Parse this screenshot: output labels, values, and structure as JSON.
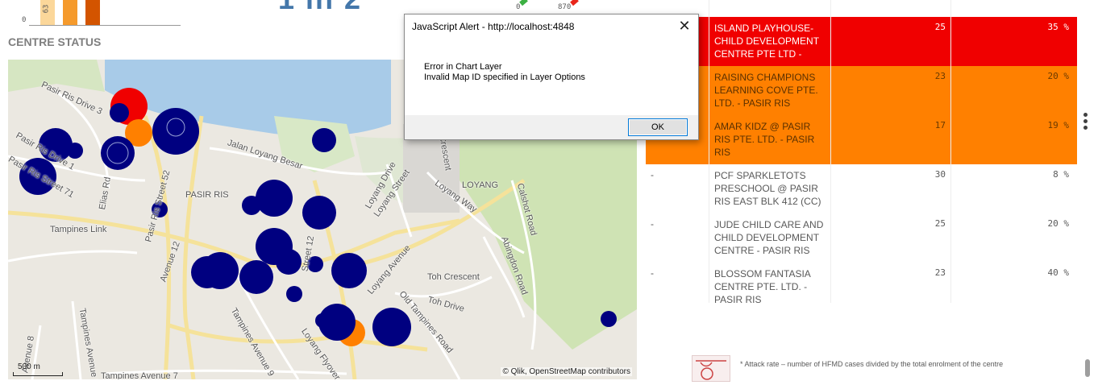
{
  "top": {
    "mini_chart": {
      "y_label": "0",
      "bar_value_label": "63"
    },
    "big_number": "1 in 2",
    "gauge_label_left": "0",
    "gauge_label_right": "870",
    "dash": "-"
  },
  "section": {
    "title": "CENTRE STATUS"
  },
  "map": {
    "labels": {
      "pasir_ris_drive_3": "Pasir Ris Drive 3",
      "pasir_ris_drive_1": "Pasir Ris Drive 1",
      "pasir_ris_street_71": "Pasir Ris Street 71",
      "elias_rd": "Elias Rd",
      "pasir_ris_street_52": "Pasir Ris Street 52",
      "pasir_ris": "PASIR RIS",
      "jalan_loyang_besar": "Jalan Loyang Besar",
      "loyang_drive": "Loyang Drive",
      "loyang_street": "Loyang Street",
      "loyang_way": "Loyang Way",
      "loyang": "LOYANG",
      "calshot_road": "Calshot Road",
      "abingdon_road": "Abingdon Road",
      "tampines_link": "Tampines Link",
      "avenue_12": "Avenue 12",
      "tampines_ave_9": "Tampines Avenue 9",
      "tampines_ave_8": "Tampines Avenue 8",
      "tampines_ave_7": "Tampines Avenue 7",
      "loyang_avenue": "Loyang Avenue",
      "toh_crescent": "Toh Crescent",
      "toh_drive": "Toh Drive",
      "old_tampines_road": "Old Tampines Road",
      "loyang_flyover": "Loyang Flyover",
      "crescent": "Crescent",
      "street_12": "Street 12",
      "avenue_8": "Avenue 8"
    },
    "scale": "500 m",
    "attribution": "© Qlik, OpenStreetMap contributors",
    "colors": {
      "high": "#f00000",
      "medium": "#ff8000",
      "low": "#000080",
      "water": "#a8cbe8",
      "green": "#cfe3b4"
    }
  },
  "table": {
    "rows": [
      {
        "status": "",
        "name": "",
        "enrolment": "",
        "rate": ""
      },
      {
        "status": "",
        "name": "ISLAND PLAYHOUSE-CHILD DEVELOPMENT CENTRE PTE LTD -",
        "enrolment": "25",
        "rate": "35 %"
      },
      {
        "status": "",
        "name": "RAISING CHAMPIONS LEARNING COVE PTE. LTD. - PASIR RIS",
        "enrolment": "23",
        "rate": "20 %"
      },
      {
        "status": "",
        "name": "AMAR KIDZ @ PASIR RIS PTE. LTD. - PASIR RIS",
        "enrolment": "17",
        "rate": "19 %"
      },
      {
        "status": "-",
        "name": "PCF SPARKLETOTS PRESCHOOL @ PASIR RIS EAST BLK 412 (CC)",
        "enrolment": "30",
        "rate": "8 %"
      },
      {
        "status": "-",
        "name": "JUDE CHILD CARE AND CHILD DEVELOPMENT CENTRE - PASIR RIS",
        "enrolment": "25",
        "rate": "20 %"
      },
      {
        "status": "-",
        "name": "BLOSSOM FANTASIA CENTRE PTE. LTD. - PASIR RIS",
        "enrolment": "23",
        "rate": "40 %"
      }
    ]
  },
  "footnote": "* Attack rate – number of HFMD cases divided by the total enrolment of the centre",
  "dialog": {
    "title": "JavaScript Alert - http://localhost:4848",
    "line1": "Error in Chart Layer",
    "line2": "Invalid Map ID specified in Layer Options",
    "ok": "OK",
    "close": "✕"
  }
}
